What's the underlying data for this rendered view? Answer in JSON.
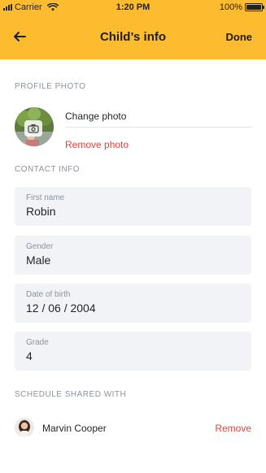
{
  "status_bar": {
    "carrier": "Carrier",
    "time": "1:20 PM",
    "battery_text": "100%",
    "battery_level": 1.0
  },
  "nav": {
    "title": "Child’s info",
    "done_label": "Done",
    "back_icon": "arrow-left-icon"
  },
  "profile_photo": {
    "section_label": "PROFILE PHOTO",
    "change_label": "Change photo",
    "remove_label": "Remove photo",
    "camera_icon": "camera-icon"
  },
  "contact_info": {
    "section_label": "CONTACT INFO",
    "fields": [
      {
        "label": "First name",
        "value": "Robin"
      },
      {
        "label": "Gender",
        "value": "Male"
      },
      {
        "label": "Date of birth",
        "value": "12 / 06 / 2004"
      },
      {
        "label": "Grade",
        "value": "4"
      }
    ]
  },
  "schedule": {
    "section_label": "SCHEDULE SHARED WITH",
    "people": [
      {
        "name": "Marvin Cooper",
        "remove_label": "Remove"
      }
    ]
  },
  "colors": {
    "header": "#fdbb30",
    "danger": "#e8413b",
    "field_bg": "#f1f3f6",
    "muted_text": "#8b939c"
  }
}
